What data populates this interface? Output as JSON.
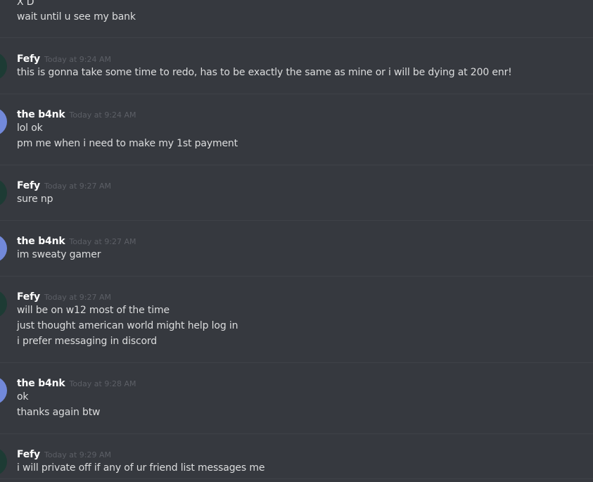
{
  "colors": {
    "background": "#36393f",
    "divider": "#3f4248",
    "username": "#ffffff",
    "timestamp": "#5c5f66",
    "message_text": "#dcddde",
    "avatar_fefy": "#1d3b34",
    "avatar_bank": "#7289da"
  },
  "top": {
    "partial_line": "X D",
    "line": "wait until u see my bank"
  },
  "messages": [
    {
      "username": "Fefy",
      "timestamp": "Today at 9:24 AM",
      "lines": [
        "this is gonna take some time to redo, has to be exactly the same as mine or i will be dying at 200 enr!"
      ]
    },
    {
      "username": "the b4nk",
      "timestamp": "Today at 9:24 AM",
      "lines": [
        "lol ok",
        "pm me when i need to make my 1st  payment"
      ]
    },
    {
      "username": "Fefy",
      "timestamp": "Today at 9:27 AM",
      "lines": [
        "sure np"
      ]
    },
    {
      "username": "the b4nk",
      "timestamp": "Today at 9:27 AM",
      "lines": [
        "im sweaty gamer"
      ]
    },
    {
      "username": "Fefy",
      "timestamp": "Today at 9:27 AM",
      "lines": [
        "will be on w12 most of the time",
        "just thought american world might help log in",
        "i prefer messaging in discord"
      ]
    },
    {
      "username": "the b4nk",
      "timestamp": "Today at 9:28 AM",
      "lines": [
        "ok",
        "thanks again btw"
      ]
    },
    {
      "username": "Fefy",
      "timestamp": "Today at 9:29 AM",
      "lines": [
        "i will private off if any of ur friend list messages me"
      ]
    }
  ]
}
